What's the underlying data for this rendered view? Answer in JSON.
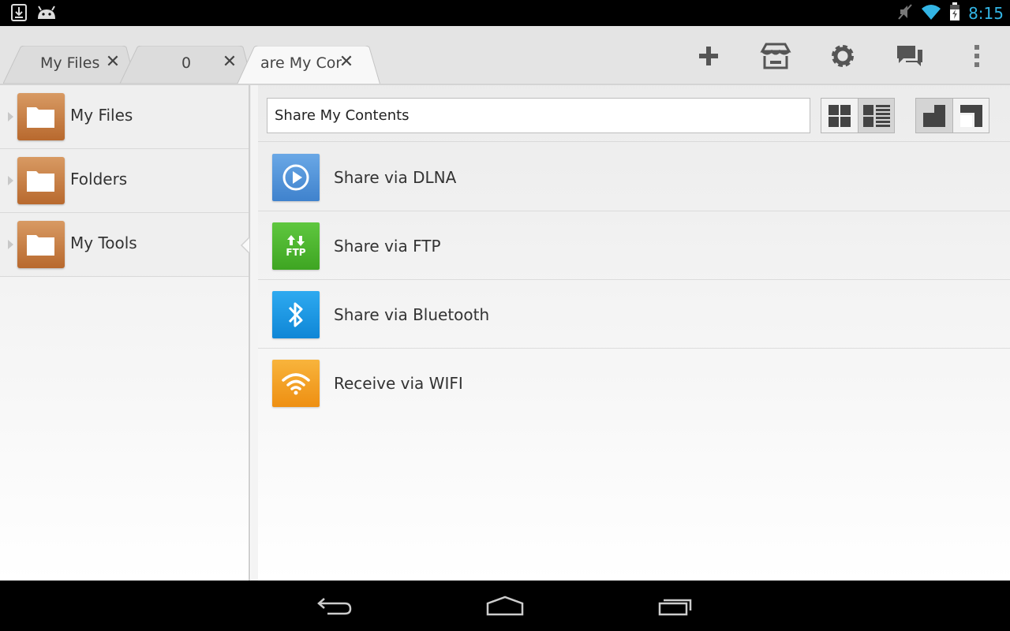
{
  "status_bar": {
    "time": "8:15",
    "left_icons": [
      "download-icon",
      "android-icon"
    ],
    "right_icons": [
      "mute-icon",
      "wifi-icon",
      "battery-charging-icon"
    ]
  },
  "tabs": [
    {
      "label": "My Files",
      "close": "✕",
      "active": false
    },
    {
      "label": "0",
      "close": "✕",
      "active": false
    },
    {
      "label": "are My Cont",
      "close": "✕",
      "active": true
    }
  ],
  "toolbar": {
    "icons": [
      "plus-icon",
      "store-icon",
      "settings-icon",
      "chat-icon",
      "overflow-menu-icon"
    ]
  },
  "sidebar": {
    "items": [
      {
        "label": "My Files",
        "selected": false
      },
      {
        "label": "Folders",
        "selected": false
      },
      {
        "label": "My Tools",
        "selected": true
      }
    ]
  },
  "main": {
    "path": "Share My Contents",
    "view_modes": [
      "grid-view-icon",
      "detail-list-view-icon"
    ],
    "active_view": "detail-list-view-icon",
    "pane_modes": [
      "single-pane-icon",
      "dual-pane-icon"
    ],
    "items": [
      {
        "label": "Share via DLNA",
        "icon": "play-icon",
        "color": "#4a90d9"
      },
      {
        "label": "Share via FTP",
        "icon": "ftp-icon",
        "icon_text": "FTP",
        "color": "#4cb52f"
      },
      {
        "label": "Share via Bluetooth",
        "icon": "bluetooth-icon",
        "color": "#1a9be6"
      },
      {
        "label": "Receive via WIFI",
        "icon": "wifi-icon",
        "color": "#f5a21f"
      }
    ]
  },
  "nav_bar": {
    "buttons": [
      "back-icon",
      "home-icon",
      "recents-icon"
    ]
  },
  "colors": {
    "accent": "#33b5e5",
    "folder": "#c67a3d"
  }
}
